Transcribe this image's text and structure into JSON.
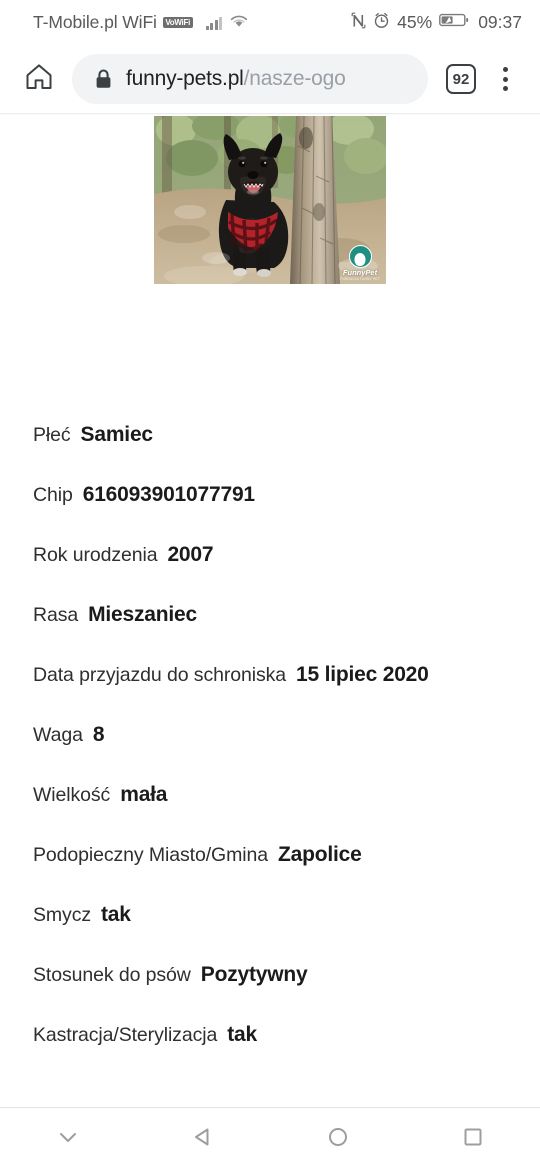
{
  "status_bar": {
    "carrier": "T-Mobile.pl WiFi",
    "vowifi_badge": "VoWiFi",
    "signal_icon": "signal-bars-icon",
    "wifi_icon": "wifi-icon",
    "nfc_icon": "nfc-icon",
    "alarm_icon": "alarm-clock-icon",
    "battery_percent": "45%",
    "battery_icon": "battery-charging-icon",
    "clock": "09:37"
  },
  "toolbar": {
    "home_icon": "home-icon",
    "lock_icon": "lock-icon",
    "url_host": "funny-pets.pl",
    "url_path": "/nasze-ogo",
    "tab_count": "92",
    "menu_icon": "overflow-menu-icon"
  },
  "content": {
    "photo_alt": "black dog with red plaid bandana sitting by a tree in the forest",
    "watermark_name": "FunnyPet",
    "watermark_sub": "FUNDACJA FUNNY PET",
    "specs": [
      {
        "label": "Płeć",
        "value": "Samiec"
      },
      {
        "label": "Chip",
        "value": "616093901077791"
      },
      {
        "label": "Rok urodzenia",
        "value": "2007"
      },
      {
        "label": "Rasa",
        "value": "Mieszaniec"
      },
      {
        "label": "Data przyjazdu do schroniska",
        "value": "15 lipiec 2020"
      },
      {
        "label": "Waga",
        "value": "8"
      },
      {
        "label": "Wielkość",
        "value": "mała"
      },
      {
        "label": "Podopieczny Miasto/Gmina",
        "value": "Zapolice"
      },
      {
        "label": "Smycz",
        "value": "tak"
      },
      {
        "label": "Stosunek do psów",
        "value": "Pozytywny"
      },
      {
        "label": "Kastracja/Sterylizacja",
        "value": "tak"
      }
    ]
  },
  "nav_bar": {
    "hide_icon": "chevron-down-icon",
    "back_icon": "back-triangle-icon",
    "home_icon": "home-circle-icon",
    "recents_icon": "recents-square-icon"
  },
  "colors": {
    "omnibox_bg": "#f1f3f4",
    "url_host": "#202124",
    "url_path": "#9aa0a6",
    "status_text": "#5a5a5a",
    "value_text": "#1b1b1b",
    "label_text": "#2f2f2f",
    "nav_icon": "#9e9e9e"
  }
}
